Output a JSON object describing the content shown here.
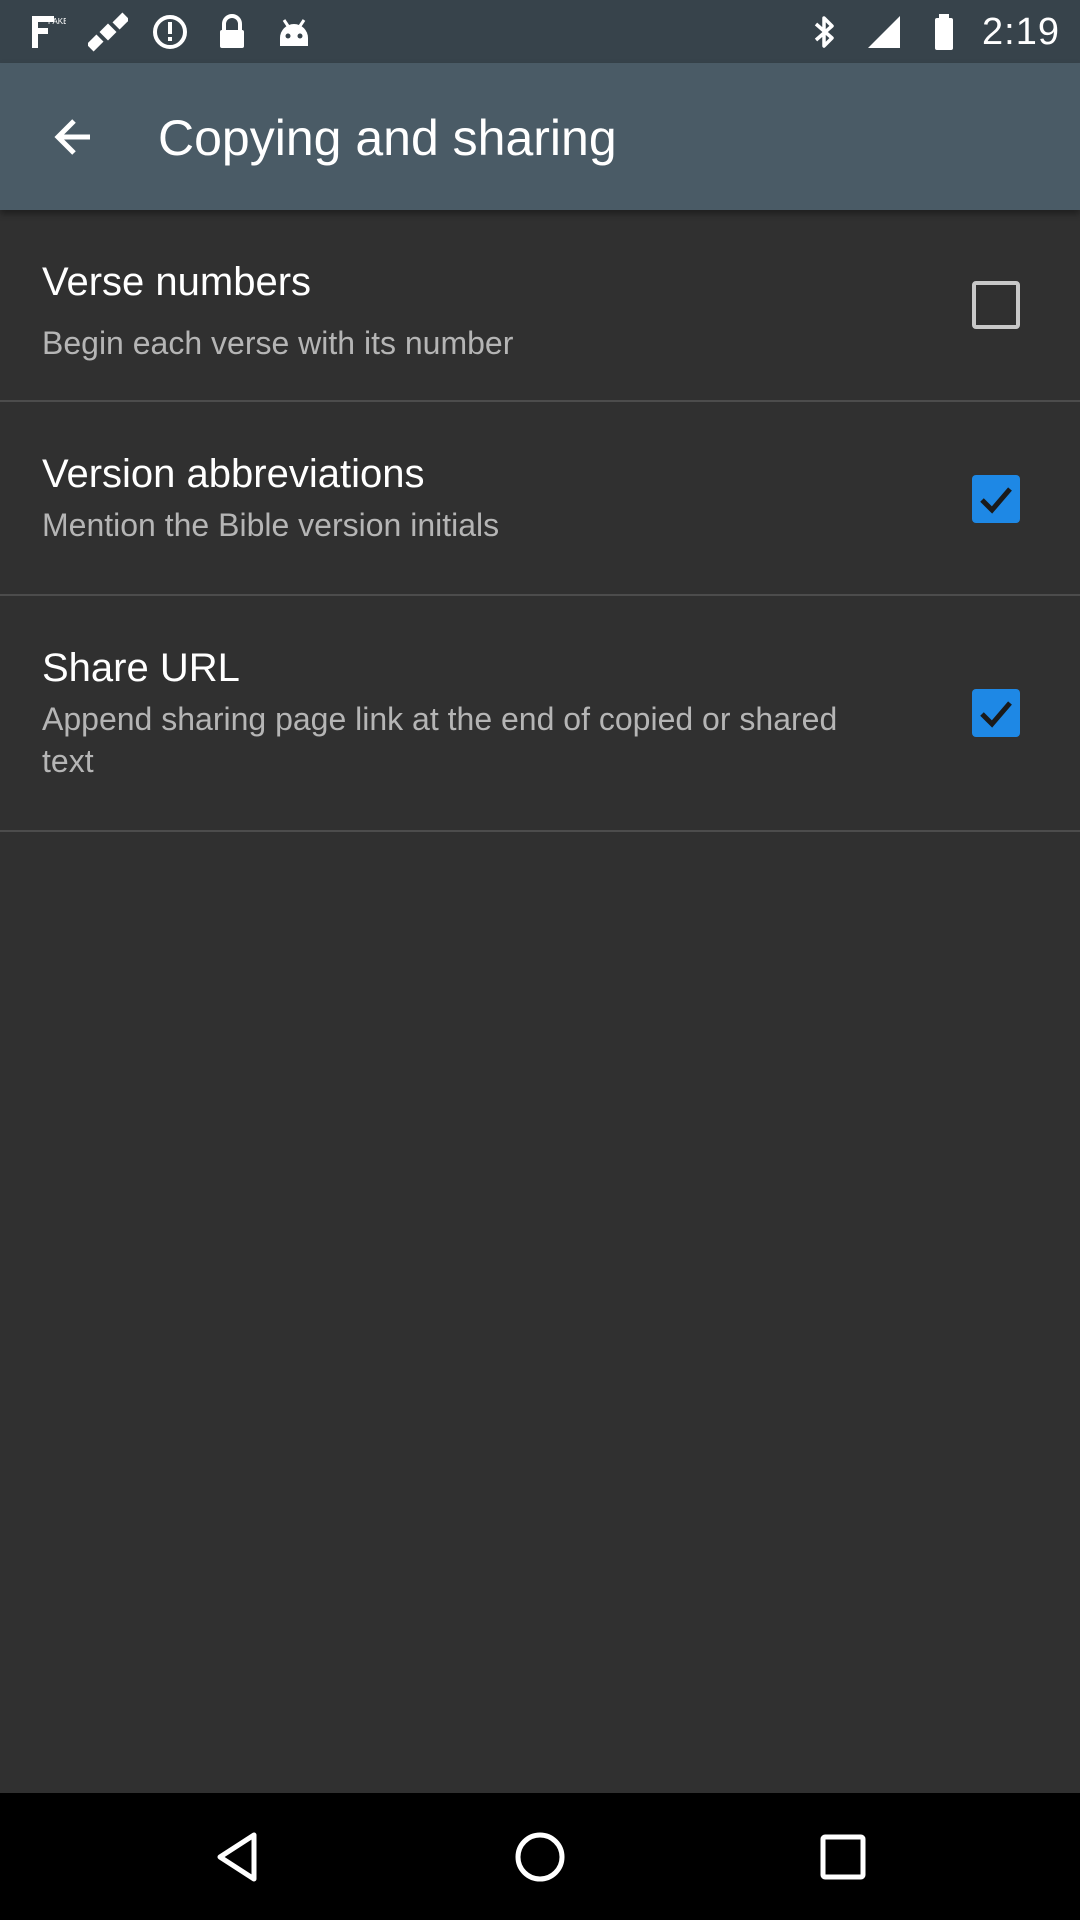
{
  "status_bar": {
    "time": "2:19",
    "left_icons": [
      "fake-gps-icon",
      "satellite-icon",
      "data-saver-icon",
      "lock-icon",
      "android-icon"
    ],
    "right_icons": [
      "bluetooth-icon",
      "signal-icon",
      "battery-icon"
    ]
  },
  "toolbar": {
    "title": "Copying and sharing",
    "back_icon": "arrow-back-icon",
    "background": "#4a5b66"
  },
  "preferences": [
    {
      "title": "Verse numbers",
      "summary": "Begin each verse with its number",
      "checked": false
    },
    {
      "title": "Version abbreviations",
      "summary": "Mention the Bible version initials",
      "checked": true
    },
    {
      "title": "Share URL",
      "summary": "Append sharing page link at the end of copied or shared text",
      "checked": true
    }
  ],
  "colors": {
    "background": "#303030",
    "checkbox_accent": "#1e88e5",
    "status_bar": "#37434b"
  },
  "nav_bar": {
    "buttons": [
      "back-triangle-icon",
      "home-circle-icon",
      "recents-square-icon"
    ]
  }
}
